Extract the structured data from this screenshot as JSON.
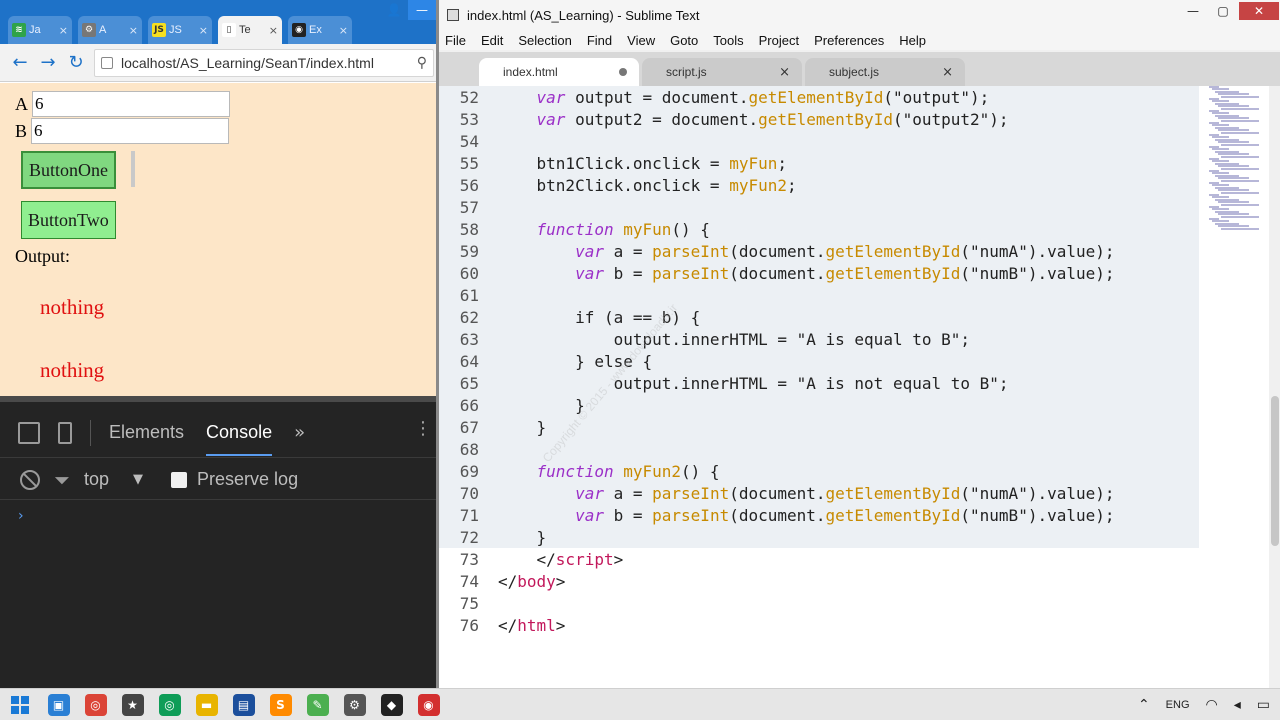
{
  "chrome": {
    "tabs": [
      {
        "title": "Ja",
        "color": "#2fa34a",
        "glyph": "≋"
      },
      {
        "title": "A",
        "color": "#777777",
        "glyph": "⚙"
      },
      {
        "title": "JS",
        "color": "#f7df1e",
        "glyph": "JS"
      },
      {
        "title": "Te",
        "color": "#ffffff",
        "glyph": "▯"
      },
      {
        "title": "Ex",
        "color": "#222222",
        "glyph": "◉"
      }
    ],
    "url": "localhost/AS_Learning/SeanT/index.html"
  },
  "page": {
    "label_a": "A",
    "value_a": "6",
    "label_b": "B",
    "value_b": "6",
    "button_one": "ButtonOne",
    "button_two": "ButtonTwo",
    "output_label": "Output:",
    "output1": "nothing",
    "output2": "nothing"
  },
  "devtools": {
    "tab_elements": "Elements",
    "tab_console": "Console",
    "more": "»",
    "context": "top",
    "preserve_log": "Preserve log",
    "prompt": "›"
  },
  "sublime": {
    "title": "index.html (AS_Learning) - Sublime Text",
    "menu": [
      "File",
      "Edit",
      "Selection",
      "Find",
      "View",
      "Goto",
      "Tools",
      "Project",
      "Preferences",
      "Help"
    ],
    "tabs": [
      {
        "name": "index.html",
        "active": true,
        "dirty": true
      },
      {
        "name": "script.js",
        "active": false,
        "dirty": false
      },
      {
        "name": "subject.js",
        "active": false,
        "dirty": false
      }
    ],
    "watermark": "Copyright © 2015 - www.downloadly.ir",
    "lines": [
      {
        "n": "52",
        "sel": true,
        "parts": [
          [
            "plain",
            "    "
          ],
          [
            "kw",
            "var"
          ],
          [
            "plain",
            " output = document."
          ],
          [
            "fn",
            "getElementById"
          ],
          [
            "plain",
            "(\"output\");"
          ]
        ]
      },
      {
        "n": "53",
        "sel": true,
        "parts": [
          [
            "plain",
            "    "
          ],
          [
            "kw",
            "var"
          ],
          [
            "plain",
            " output2 = document."
          ],
          [
            "fn",
            "getElementById"
          ],
          [
            "plain",
            "(\"output2\");"
          ]
        ]
      },
      {
        "n": "54",
        "sel": true,
        "parts": []
      },
      {
        "n": "55",
        "sel": true,
        "parts": [
          [
            "plain",
            "    btn1Click.onclick = "
          ],
          [
            "fn",
            "myFun"
          ],
          [
            "plain",
            ";"
          ]
        ]
      },
      {
        "n": "56",
        "sel": true,
        "parts": [
          [
            "plain",
            "    btn2Click.onclick = "
          ],
          [
            "fn",
            "myFun2"
          ],
          [
            "plain",
            ";"
          ]
        ]
      },
      {
        "n": "57",
        "sel": true,
        "parts": []
      },
      {
        "n": "58",
        "sel": true,
        "parts": [
          [
            "plain",
            "    "
          ],
          [
            "kw",
            "function"
          ],
          [
            "plain",
            " "
          ],
          [
            "fn",
            "myFun"
          ],
          [
            "plain",
            "() {"
          ]
        ]
      },
      {
        "n": "59",
        "sel": true,
        "parts": [
          [
            "plain",
            "        "
          ],
          [
            "kw",
            "var"
          ],
          [
            "plain",
            " a = "
          ],
          [
            "fn",
            "parseInt"
          ],
          [
            "plain",
            "(document."
          ],
          [
            "fn",
            "getElementById"
          ],
          [
            "plain",
            "(\"numA\").value);"
          ]
        ]
      },
      {
        "n": "60",
        "sel": true,
        "parts": [
          [
            "plain",
            "        "
          ],
          [
            "kw",
            "var"
          ],
          [
            "plain",
            " b = "
          ],
          [
            "fn",
            "parseInt"
          ],
          [
            "plain",
            "(document."
          ],
          [
            "fn",
            "getElementById"
          ],
          [
            "plain",
            "(\"numB\").value);"
          ]
        ]
      },
      {
        "n": "61",
        "sel": true,
        "parts": []
      },
      {
        "n": "62",
        "sel": true,
        "parts": [
          [
            "plain",
            "        if (a == b) {"
          ]
        ]
      },
      {
        "n": "63",
        "sel": true,
        "parts": [
          [
            "plain",
            "            output.innerHTML = \"A is equal to B\";"
          ]
        ]
      },
      {
        "n": "64",
        "sel": true,
        "parts": [
          [
            "plain",
            "        } else {"
          ]
        ]
      },
      {
        "n": "65",
        "sel": true,
        "parts": [
          [
            "plain",
            "            output.innerHTML = \"A is not equal to B\";"
          ]
        ]
      },
      {
        "n": "66",
        "sel": true,
        "parts": [
          [
            "plain",
            "        }"
          ]
        ]
      },
      {
        "n": "67",
        "sel": true,
        "parts": [
          [
            "plain",
            "    }"
          ]
        ]
      },
      {
        "n": "68",
        "sel": true,
        "parts": []
      },
      {
        "n": "69",
        "sel": true,
        "parts": [
          [
            "plain",
            "    "
          ],
          [
            "kw",
            "function"
          ],
          [
            "plain",
            " "
          ],
          [
            "fn",
            "myFun2"
          ],
          [
            "plain",
            "() {"
          ]
        ]
      },
      {
        "n": "70",
        "sel": true,
        "parts": [
          [
            "plain",
            "        "
          ],
          [
            "kw",
            "var"
          ],
          [
            "plain",
            " a = "
          ],
          [
            "fn",
            "parseInt"
          ],
          [
            "plain",
            "(document."
          ],
          [
            "fn",
            "getElementById"
          ],
          [
            "plain",
            "(\"numA\").value);"
          ]
        ]
      },
      {
        "n": "71",
        "sel": true,
        "parts": [
          [
            "plain",
            "        "
          ],
          [
            "kw",
            "var"
          ],
          [
            "plain",
            " b = "
          ],
          [
            "fn",
            "parseInt"
          ],
          [
            "plain",
            "(document."
          ],
          [
            "fn",
            "getElementById"
          ],
          [
            "plain",
            "(\"numB\").value);"
          ]
        ]
      },
      {
        "n": "72",
        "sel": true,
        "parts": [
          [
            "plain",
            "    }"
          ]
        ]
      },
      {
        "n": "73",
        "sel": false,
        "parts": [
          [
            "plain",
            "    </"
          ],
          [
            "tag",
            "script"
          ],
          [
            "plain",
            ">"
          ]
        ]
      },
      {
        "n": "74",
        "sel": false,
        "parts": [
          [
            "plain",
            "</"
          ],
          [
            "tag",
            "body"
          ],
          [
            "plain",
            ">"
          ]
        ]
      },
      {
        "n": "75",
        "sel": false,
        "parts": []
      },
      {
        "n": "76",
        "sel": false,
        "parts": [
          [
            "plain",
            "</"
          ],
          [
            "tag",
            "html"
          ],
          [
            "plain",
            ">"
          ]
        ]
      }
    ]
  },
  "taskbar": {
    "apps": [
      {
        "name": "screenshot-app-icon",
        "color": "#2a7fd4",
        "glyph": "▣"
      },
      {
        "name": "chrome-icon",
        "color": "#db4437",
        "glyph": "◎"
      },
      {
        "name": "movie-maker-icon",
        "color": "#444444",
        "glyph": "★"
      },
      {
        "name": "chrome-canary-icon",
        "color": "#0f9d58",
        "glyph": "◎"
      },
      {
        "name": "file-explorer-icon",
        "color": "#e8b400",
        "glyph": "▬"
      },
      {
        "name": "save-app-icon",
        "color": "#1c4f9c",
        "glyph": "▤"
      },
      {
        "name": "sublime-icon",
        "color": "#ff8a00",
        "glyph": "S"
      },
      {
        "name": "notepad-icon",
        "color": "#4caf50",
        "glyph": "✎"
      },
      {
        "name": "settings-icon",
        "color": "#555555",
        "glyph": "⚙"
      },
      {
        "name": "unity-icon",
        "color": "#222222",
        "glyph": "◆"
      },
      {
        "name": "audio-app-icon",
        "color": "#d32f2f",
        "glyph": "◉"
      }
    ],
    "language": "ENG"
  }
}
